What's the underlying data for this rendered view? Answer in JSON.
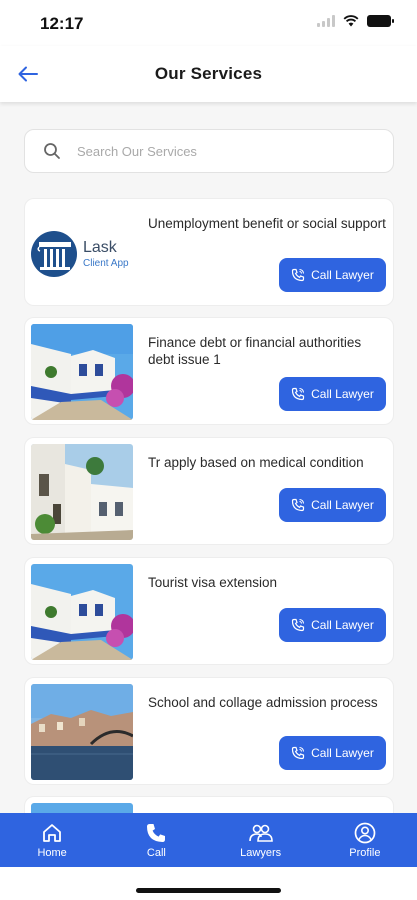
{
  "status_bar": {
    "time": "12:17"
  },
  "header": {
    "title": "Our Services"
  },
  "search": {
    "placeholder": "Search Our Services"
  },
  "call_button_label": "Call Lawyer",
  "logo": {
    "name": "Lask",
    "subtitle": "Client App"
  },
  "services": [
    {
      "title": "Unemployment benefit or social support",
      "thumb": "logo"
    },
    {
      "title": "Finance debt or financial authorities debt issue 1",
      "thumb": "village-street"
    },
    {
      "title": "Tr apply based on medical condition",
      "thumb": "white-houses"
    },
    {
      "title": "Tourist visa extension",
      "thumb": "village-street"
    },
    {
      "title": "School and collage admission process",
      "thumb": "river-city"
    }
  ],
  "bottom_nav": [
    {
      "label": "Home",
      "icon": "home-icon"
    },
    {
      "label": "Call",
      "icon": "phone-icon"
    },
    {
      "label": "Lawyers",
      "icon": "users-icon"
    },
    {
      "label": "Profile",
      "icon": "user-circle-icon"
    }
  ],
  "colors": {
    "accent": "#2f64e0",
    "background": "#f6f6f6"
  }
}
